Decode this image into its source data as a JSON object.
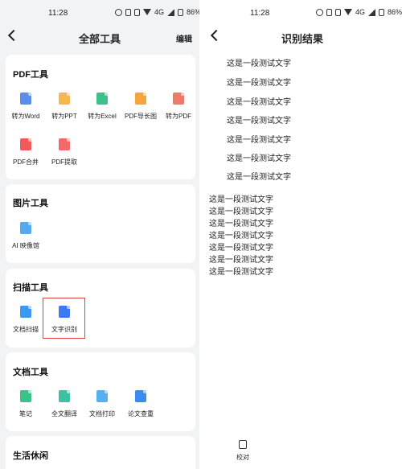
{
  "left": {
    "status": {
      "time": "11:28",
      "battery": "86%",
      "network": "4G"
    },
    "header": {
      "title": "全部工具",
      "edit": "编辑"
    },
    "sections": [
      {
        "title": "PDF工具",
        "tools": [
          {
            "label": "转为Word",
            "icon": "word-icon",
            "color": "#5b8def"
          },
          {
            "label": "转为PPT",
            "icon": "ppt-icon",
            "color": "#f5b94b"
          },
          {
            "label": "转为Excel",
            "icon": "excel-icon",
            "color": "#3bc28a"
          },
          {
            "label": "PDF导长图",
            "icon": "image-icon",
            "color": "#f5a53b"
          },
          {
            "label": "转为PDF",
            "icon": "pdf-icon",
            "color": "#f07a6a"
          },
          {
            "label": "PDF合并",
            "icon": "merge-icon",
            "color": "#f05a5a"
          },
          {
            "label": "PDF提取",
            "icon": "extract-icon",
            "color": "#f06a6a"
          }
        ]
      },
      {
        "title": "图片工具",
        "tools": [
          {
            "label": "AI 映像馆",
            "icon": "ai-image-icon",
            "color": "#56a8f0"
          }
        ]
      },
      {
        "title": "扫描工具",
        "tools": [
          {
            "label": "文档扫描",
            "icon": "scan-icon",
            "color": "#3a9af0"
          },
          {
            "label": "文字识别",
            "icon": "ocr-icon",
            "color": "#3a7bf0"
          }
        ]
      },
      {
        "title": "文档工具",
        "tools": [
          {
            "label": "笔记",
            "icon": "note-icon",
            "color": "#3bc28a"
          },
          {
            "label": "全文翻译",
            "icon": "translate-icon",
            "color": "#3bc2a0"
          },
          {
            "label": "文档打印",
            "icon": "print-icon",
            "color": "#56b0f0"
          },
          {
            "label": "论文查重",
            "icon": "check-paper-icon",
            "color": "#3a8af0"
          }
        ]
      },
      {
        "title": "生活休闲",
        "tools": []
      }
    ]
  },
  "right": {
    "status": {
      "time": "11:28",
      "battery": "86%",
      "network": "4G"
    },
    "header": {
      "title": "识别结果"
    },
    "result_lines_indented": [
      "这是一段测试文字",
      "这是一段测试文字",
      "这是一段测试文字",
      "这是一段测试文字",
      "这是一段测试文字",
      "这是一段测试文字",
      "这是一段测试文字"
    ],
    "result_lines_plain": [
      "这是一段测试文字",
      "这是一段测试文字",
      "这是一段测试文字",
      "这是一段测试文字",
      "这是一段测试文字",
      "这是一段测试文字",
      "这是一段测试文字"
    ],
    "bottom": {
      "proofread": "校对"
    }
  }
}
